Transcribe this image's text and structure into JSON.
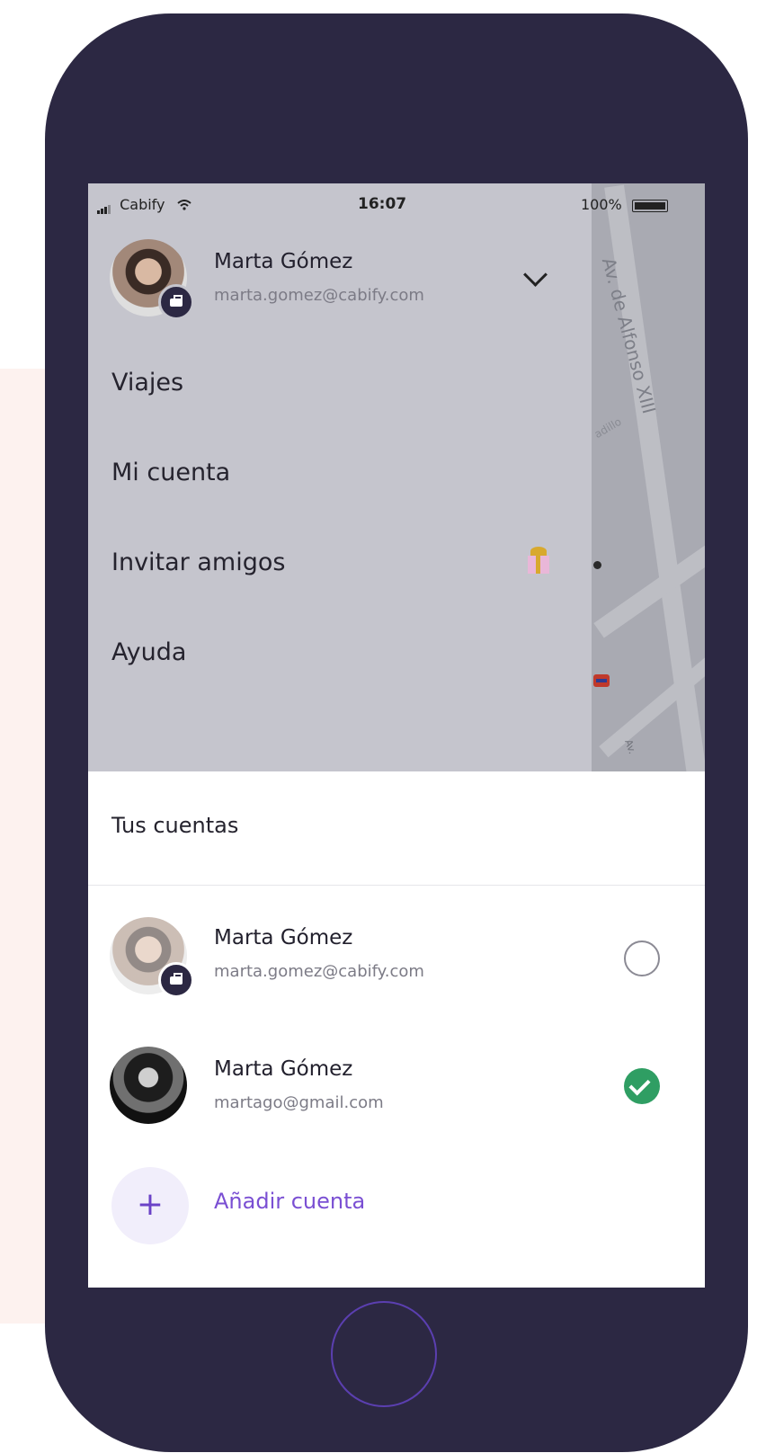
{
  "status_bar": {
    "carrier": "Cabify",
    "time": "16:07",
    "battery": "100%"
  },
  "map": {
    "street": "Av. de Alfonso XIII",
    "street_small": "adillo",
    "street_bottom": "Av."
  },
  "drawer": {
    "profile": {
      "name": "Marta Gómez",
      "email": "marta.gomez@cabify.com"
    },
    "menu": [
      {
        "label": "Viajes"
      },
      {
        "label": "Mi cuenta"
      },
      {
        "label": "Invitar amigos",
        "icon": "gift-icon"
      },
      {
        "label": "Ayuda"
      }
    ]
  },
  "accounts": {
    "title": "Tus cuentas",
    "items": [
      {
        "name": "Marta Gómez",
        "email": "marta.gomez@cabify.com",
        "selected": false,
        "type": "business"
      },
      {
        "name": "Marta Gómez",
        "email": "martago@gmail.com",
        "selected": true,
        "type": "personal"
      }
    ],
    "add_label": "Añadir cuenta",
    "add_icon": "+"
  },
  "colors": {
    "phone": "#2c2843",
    "accent": "#7a4fd3",
    "selected": "#2f9e63",
    "pink_bg": "#fdf2ef"
  }
}
